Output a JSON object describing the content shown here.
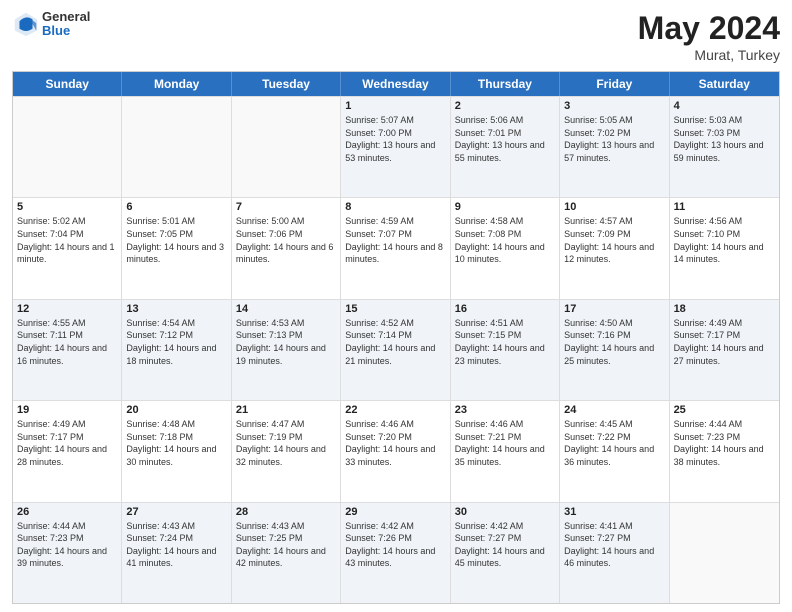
{
  "header": {
    "logo": {
      "general": "General",
      "blue": "Blue"
    },
    "title": "May 2024",
    "location": "Murat, Turkey"
  },
  "weekdays": [
    "Sunday",
    "Monday",
    "Tuesday",
    "Wednesday",
    "Thursday",
    "Friday",
    "Saturday"
  ],
  "rows": [
    [
      {
        "day": "",
        "text": "",
        "empty": true
      },
      {
        "day": "",
        "text": "",
        "empty": true
      },
      {
        "day": "",
        "text": "",
        "empty": true
      },
      {
        "day": "1",
        "text": "Sunrise: 5:07 AM\nSunset: 7:00 PM\nDaylight: 13 hours and 53 minutes."
      },
      {
        "day": "2",
        "text": "Sunrise: 5:06 AM\nSunset: 7:01 PM\nDaylight: 13 hours and 55 minutes."
      },
      {
        "day": "3",
        "text": "Sunrise: 5:05 AM\nSunset: 7:02 PM\nDaylight: 13 hours and 57 minutes."
      },
      {
        "day": "4",
        "text": "Sunrise: 5:03 AM\nSunset: 7:03 PM\nDaylight: 13 hours and 59 minutes."
      }
    ],
    [
      {
        "day": "5",
        "text": "Sunrise: 5:02 AM\nSunset: 7:04 PM\nDaylight: 14 hours and 1 minute."
      },
      {
        "day": "6",
        "text": "Sunrise: 5:01 AM\nSunset: 7:05 PM\nDaylight: 14 hours and 3 minutes."
      },
      {
        "day": "7",
        "text": "Sunrise: 5:00 AM\nSunset: 7:06 PM\nDaylight: 14 hours and 6 minutes."
      },
      {
        "day": "8",
        "text": "Sunrise: 4:59 AM\nSunset: 7:07 PM\nDaylight: 14 hours and 8 minutes."
      },
      {
        "day": "9",
        "text": "Sunrise: 4:58 AM\nSunset: 7:08 PM\nDaylight: 14 hours and 10 minutes."
      },
      {
        "day": "10",
        "text": "Sunrise: 4:57 AM\nSunset: 7:09 PM\nDaylight: 14 hours and 12 minutes."
      },
      {
        "day": "11",
        "text": "Sunrise: 4:56 AM\nSunset: 7:10 PM\nDaylight: 14 hours and 14 minutes."
      }
    ],
    [
      {
        "day": "12",
        "text": "Sunrise: 4:55 AM\nSunset: 7:11 PM\nDaylight: 14 hours and 16 minutes."
      },
      {
        "day": "13",
        "text": "Sunrise: 4:54 AM\nSunset: 7:12 PM\nDaylight: 14 hours and 18 minutes."
      },
      {
        "day": "14",
        "text": "Sunrise: 4:53 AM\nSunset: 7:13 PM\nDaylight: 14 hours and 19 minutes."
      },
      {
        "day": "15",
        "text": "Sunrise: 4:52 AM\nSunset: 7:14 PM\nDaylight: 14 hours and 21 minutes."
      },
      {
        "day": "16",
        "text": "Sunrise: 4:51 AM\nSunset: 7:15 PM\nDaylight: 14 hours and 23 minutes."
      },
      {
        "day": "17",
        "text": "Sunrise: 4:50 AM\nSunset: 7:16 PM\nDaylight: 14 hours and 25 minutes."
      },
      {
        "day": "18",
        "text": "Sunrise: 4:49 AM\nSunset: 7:17 PM\nDaylight: 14 hours and 27 minutes."
      }
    ],
    [
      {
        "day": "19",
        "text": "Sunrise: 4:49 AM\nSunset: 7:17 PM\nDaylight: 14 hours and 28 minutes."
      },
      {
        "day": "20",
        "text": "Sunrise: 4:48 AM\nSunset: 7:18 PM\nDaylight: 14 hours and 30 minutes."
      },
      {
        "day": "21",
        "text": "Sunrise: 4:47 AM\nSunset: 7:19 PM\nDaylight: 14 hours and 32 minutes."
      },
      {
        "day": "22",
        "text": "Sunrise: 4:46 AM\nSunset: 7:20 PM\nDaylight: 14 hours and 33 minutes."
      },
      {
        "day": "23",
        "text": "Sunrise: 4:46 AM\nSunset: 7:21 PM\nDaylight: 14 hours and 35 minutes."
      },
      {
        "day": "24",
        "text": "Sunrise: 4:45 AM\nSunset: 7:22 PM\nDaylight: 14 hours and 36 minutes."
      },
      {
        "day": "25",
        "text": "Sunrise: 4:44 AM\nSunset: 7:23 PM\nDaylight: 14 hours and 38 minutes."
      }
    ],
    [
      {
        "day": "26",
        "text": "Sunrise: 4:44 AM\nSunset: 7:23 PM\nDaylight: 14 hours and 39 minutes."
      },
      {
        "day": "27",
        "text": "Sunrise: 4:43 AM\nSunset: 7:24 PM\nDaylight: 14 hours and 41 minutes."
      },
      {
        "day": "28",
        "text": "Sunrise: 4:43 AM\nSunset: 7:25 PM\nDaylight: 14 hours and 42 minutes."
      },
      {
        "day": "29",
        "text": "Sunrise: 4:42 AM\nSunset: 7:26 PM\nDaylight: 14 hours and 43 minutes."
      },
      {
        "day": "30",
        "text": "Sunrise: 4:42 AM\nSunset: 7:27 PM\nDaylight: 14 hours and 45 minutes."
      },
      {
        "day": "31",
        "text": "Sunrise: 4:41 AM\nSunset: 7:27 PM\nDaylight: 14 hours and 46 minutes."
      },
      {
        "day": "",
        "text": "",
        "empty": true
      }
    ]
  ]
}
